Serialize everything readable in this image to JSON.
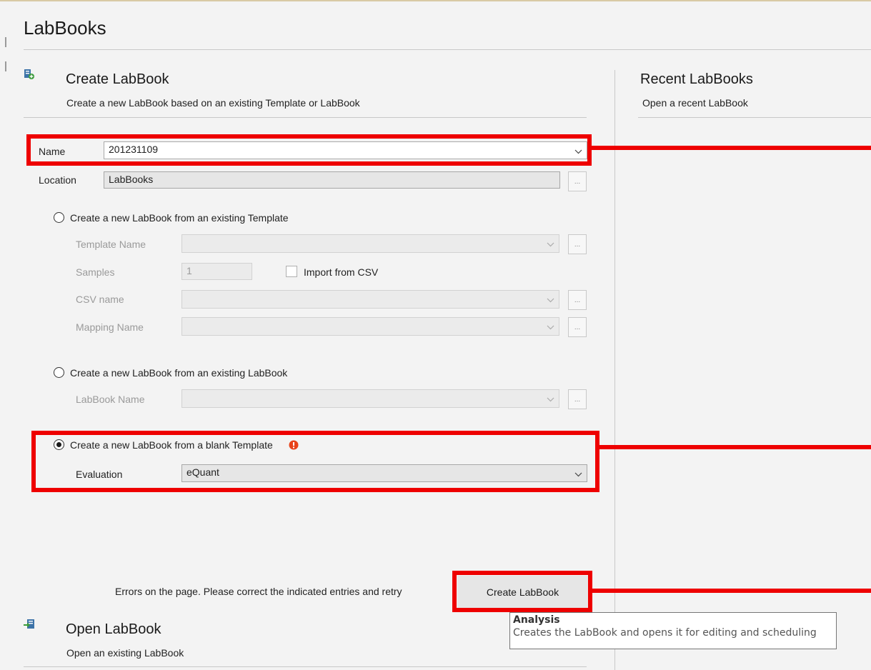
{
  "page": {
    "title": "LabBooks"
  },
  "create": {
    "title": "Create LabBook",
    "subtitle": "Create a new LabBook based on an existing Template or LabBook",
    "name_label": "Name",
    "name_value": "201231109",
    "location_label": "Location",
    "location_value": "LabBooks",
    "browse_label": "...",
    "option_template": {
      "label": "Create a new LabBook from an existing Template",
      "template_name_label": "Template Name",
      "samples_label": "Samples",
      "samples_value": "1",
      "import_csv_label": "Import from CSV",
      "csv_name_label": "CSV name",
      "mapping_name_label": "Mapping Name"
    },
    "option_labbook": {
      "label": "Create a new LabBook from an existing LabBook",
      "labbook_name_label": "LabBook Name"
    },
    "option_blank": {
      "label": "Create a new LabBook from a blank Template",
      "selected": true,
      "evaluation_label": "Evaluation",
      "evaluation_value": "eQuant"
    },
    "error_message": "Errors on the page. Please correct the indicated entries and retry",
    "create_button_label": "Create LabBook"
  },
  "tooltip": {
    "title": "Analysis",
    "text": "Creates the LabBook and opens it for editing and scheduling"
  },
  "open": {
    "title": "Open LabBook",
    "subtitle": "Open an existing LabBook"
  },
  "recent": {
    "title": "Recent LabBooks",
    "subtitle": "Open a recent LabBook"
  },
  "colors": {
    "annotation": "#ee0000",
    "error_icon": "#e8431a",
    "icon_blue": "#3d73a8",
    "icon_green": "#3a9a3a"
  }
}
